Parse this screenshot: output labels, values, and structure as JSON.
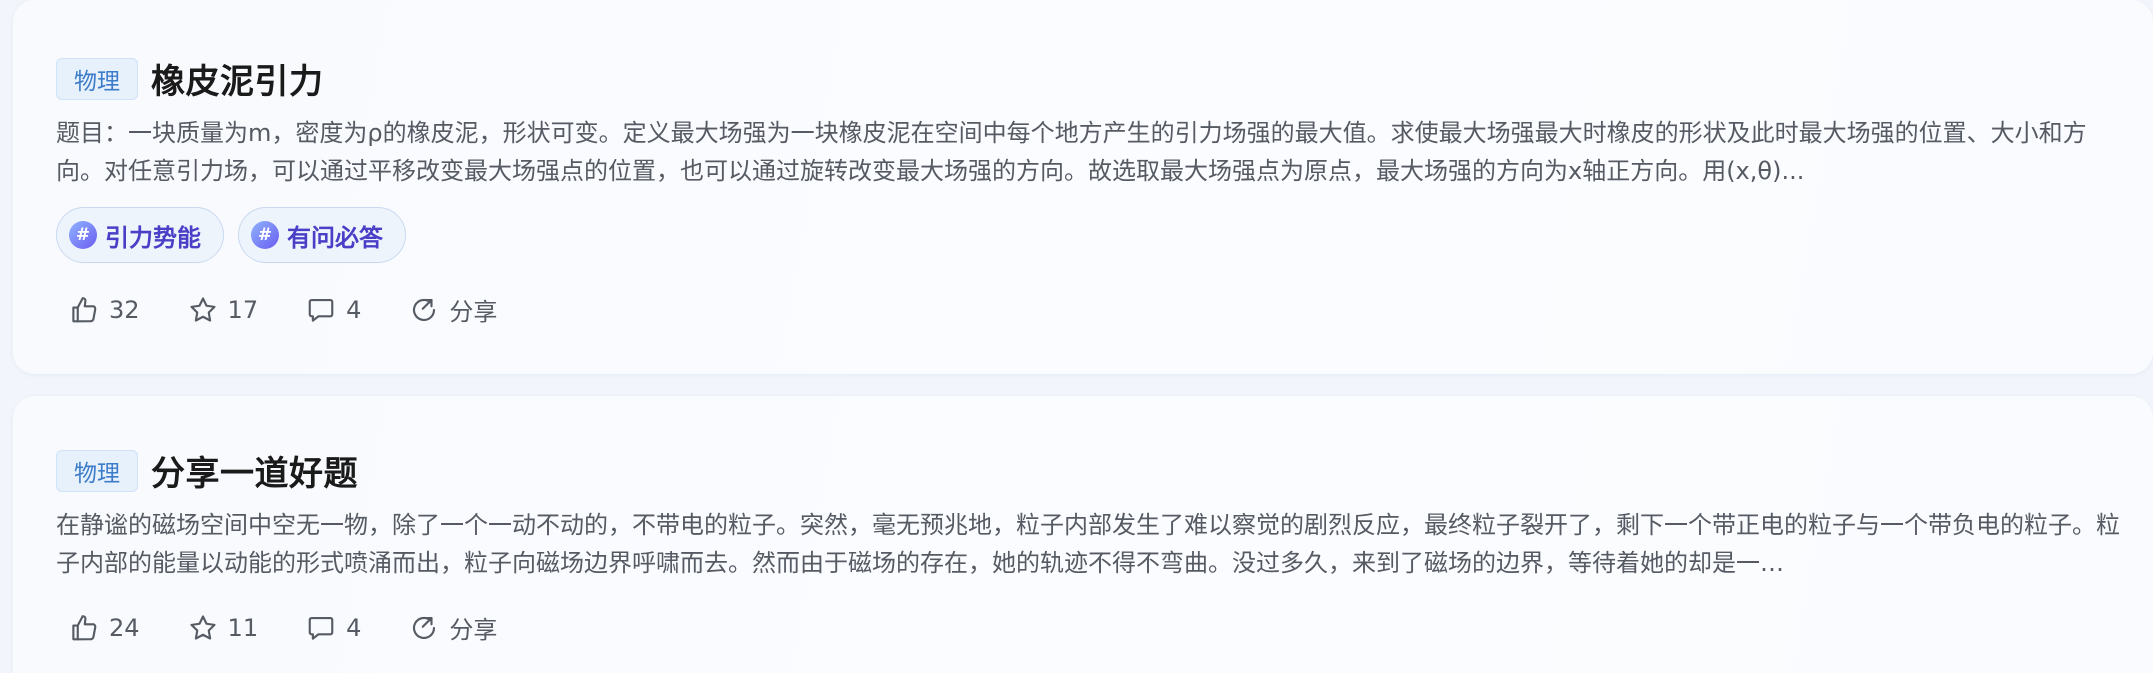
{
  "posts": [
    {
      "subject": "物理",
      "title": "橡皮泥引力",
      "body": "题目：一块质量为m，密度为ρ的橡皮泥，形状可变。定义最大场强为一块橡皮泥在空间中每个地方产生的引力场强的最大值。求使最大场强最大时橡皮的形状及此时最大场强的位置、大小和方向。对任意引力场，可以通过平移改变最大场强点的位置，也可以通过旋转改变最大场强的方向。故选取最大场强点为原点，最大场强的方向为x轴正方向。用(x,θ)...",
      "tags": [
        "引力势能",
        "有问必答"
      ],
      "likes": "32",
      "favorites": "17",
      "comments": "4",
      "share_label": "分享"
    },
    {
      "subject": "物理",
      "title": "分享一道好题",
      "body": "在静谧的磁场空间中空无一物，除了一个一动不动的，不带电的粒子。突然，毫无预兆地，粒子内部发生了难以察觉的剧烈反应，最终粒子裂开了，剩下一个带正电的粒子与一个带负电的粒子。粒子内部的能量以动能的形式喷涌而出，粒子向磁场边界呼啸而去。然而由于磁场的存在，她的轨迹不得不弯曲。没过多久，来到了磁场的边界，等待着她的却是一…",
      "tags": [],
      "likes": "24",
      "favorites": "11",
      "comments": "4",
      "share_label": "分享"
    }
  ],
  "icons": {
    "like": "thumbs-up-icon",
    "favorite": "star-icon",
    "comment": "comment-icon",
    "share": "share-icon",
    "tag": "hash-icon"
  },
  "colors": {
    "badge_text": "#3d7cc9",
    "tag_text": "#4a3fc6",
    "title": "#1a1a1a",
    "body": "#555a63"
  }
}
